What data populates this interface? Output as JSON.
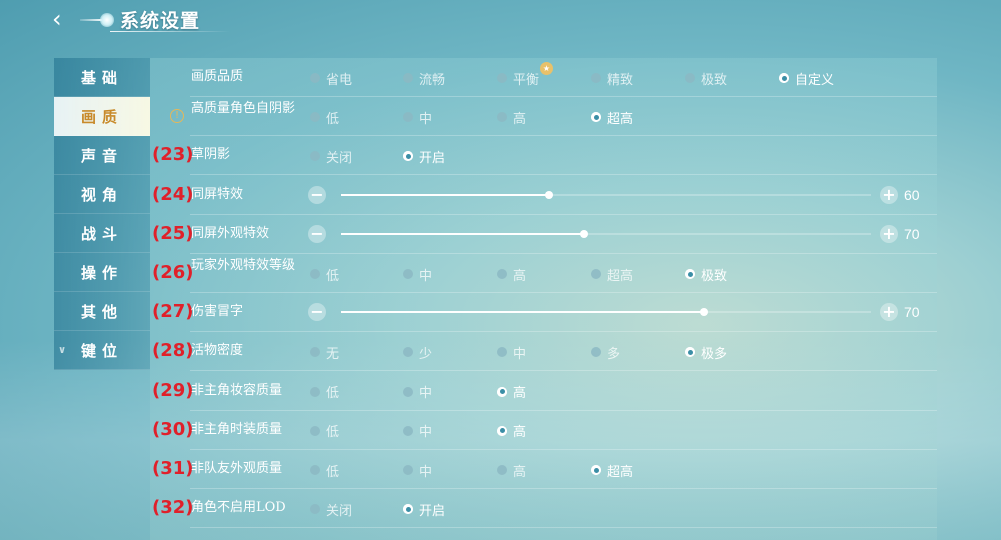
{
  "header": {
    "title": "系统设置",
    "back_icon": "back-arrow-icon"
  },
  "sidebar": {
    "items": [
      {
        "label": "基础",
        "active": false
      },
      {
        "label": "画质",
        "active": true
      },
      {
        "label": "声音",
        "active": false
      },
      {
        "label": "视角",
        "active": false
      },
      {
        "label": "战斗",
        "active": false
      },
      {
        "label": "操作",
        "active": false
      },
      {
        "label": "其他",
        "active": false
      },
      {
        "label": "键位",
        "active": false,
        "chevron": true
      }
    ]
  },
  "rows": [
    {
      "num": "",
      "label": "画质品质",
      "type": "radio",
      "options": [
        "省电",
        "流畅",
        "平衡",
        "精致",
        "极致",
        "自定义"
      ],
      "selected": 5,
      "badge_after": 2
    },
    {
      "num": "",
      "label": "高质量角色自阴影",
      "type": "radio",
      "options": [
        "低",
        "中",
        "高",
        "超高"
      ],
      "selected": 3,
      "warn": true
    },
    {
      "num": "(23)",
      "label": "草阴影",
      "type": "radio",
      "options": [
        "关闭",
        "开启"
      ],
      "selected": 1
    },
    {
      "num": "(24)",
      "label": "同屏特效",
      "type": "slider",
      "value": 60,
      "fraction": 0.393
    },
    {
      "num": "(25)",
      "label": "同屏外观特效",
      "type": "slider",
      "value": 70,
      "fraction": 0.459
    },
    {
      "num": "(26)",
      "label": "玩家外观特效等级",
      "type": "radio",
      "options": [
        "低",
        "中",
        "高",
        "超高",
        "极致"
      ],
      "selected": 4
    },
    {
      "num": "(27)",
      "label": "伤害冒字",
      "type": "slider",
      "value": 70,
      "fraction": 0.685
    },
    {
      "num": "(28)",
      "label": "活物密度",
      "type": "radio",
      "options": [
        "无",
        "少",
        "中",
        "多",
        "极多"
      ],
      "selected": 4
    },
    {
      "num": "(29)",
      "label": "非主角妆容质量",
      "type": "radio",
      "options": [
        "低",
        "中",
        "高"
      ],
      "selected": 2
    },
    {
      "num": "(30)",
      "label": "非主角时装质量",
      "type": "radio",
      "options": [
        "低",
        "中",
        "高"
      ],
      "selected": 2
    },
    {
      "num": "(31)",
      "label": "非队友外观质量",
      "type": "radio",
      "options": [
        "低",
        "中",
        "高",
        "超高"
      ],
      "selected": 3
    },
    {
      "num": "(32)",
      "label": "角色不启用LOD",
      "type": "radio",
      "options": [
        "关闭",
        "开启"
      ],
      "selected": 1
    }
  ],
  "colors": {
    "accent": "#c88a2a",
    "annotation": "#e0202a",
    "selected_dot": "#3b8ea6"
  }
}
